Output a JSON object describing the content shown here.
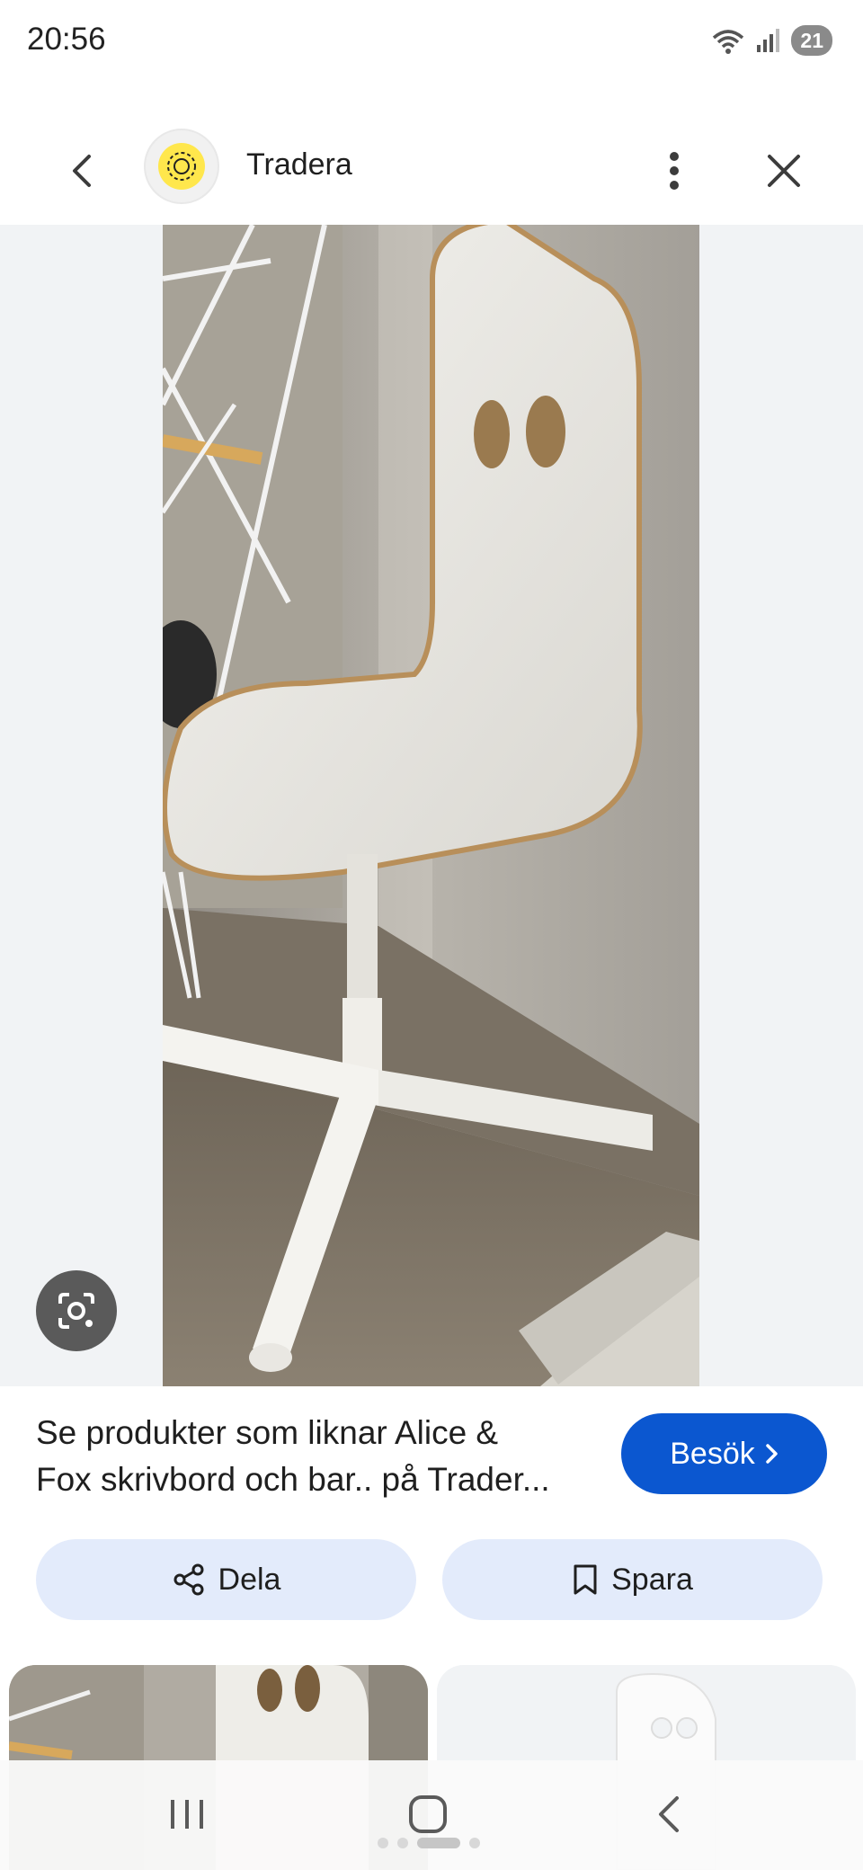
{
  "status_bar": {
    "time": "20:56",
    "battery": "21"
  },
  "header": {
    "site_name": "Tradera",
    "logo_text": "TRADERA"
  },
  "result": {
    "title_line1": "Se produkter som liknar Alice &",
    "title_line2": "Fox skrivbord och bar.. på Trader...",
    "visit_label": "Besök",
    "share_label": "Dela",
    "save_label": "Spara"
  },
  "icons": {
    "back": "chevron-left-icon",
    "more": "more-vert-icon",
    "close": "close-icon",
    "lens": "google-lens-icon",
    "share": "share-icon",
    "save": "bookmark-icon"
  },
  "colors": {
    "accent": "#0b57d0",
    "pill_bg": "#e3ebfb",
    "logo": "#ffe74c"
  }
}
